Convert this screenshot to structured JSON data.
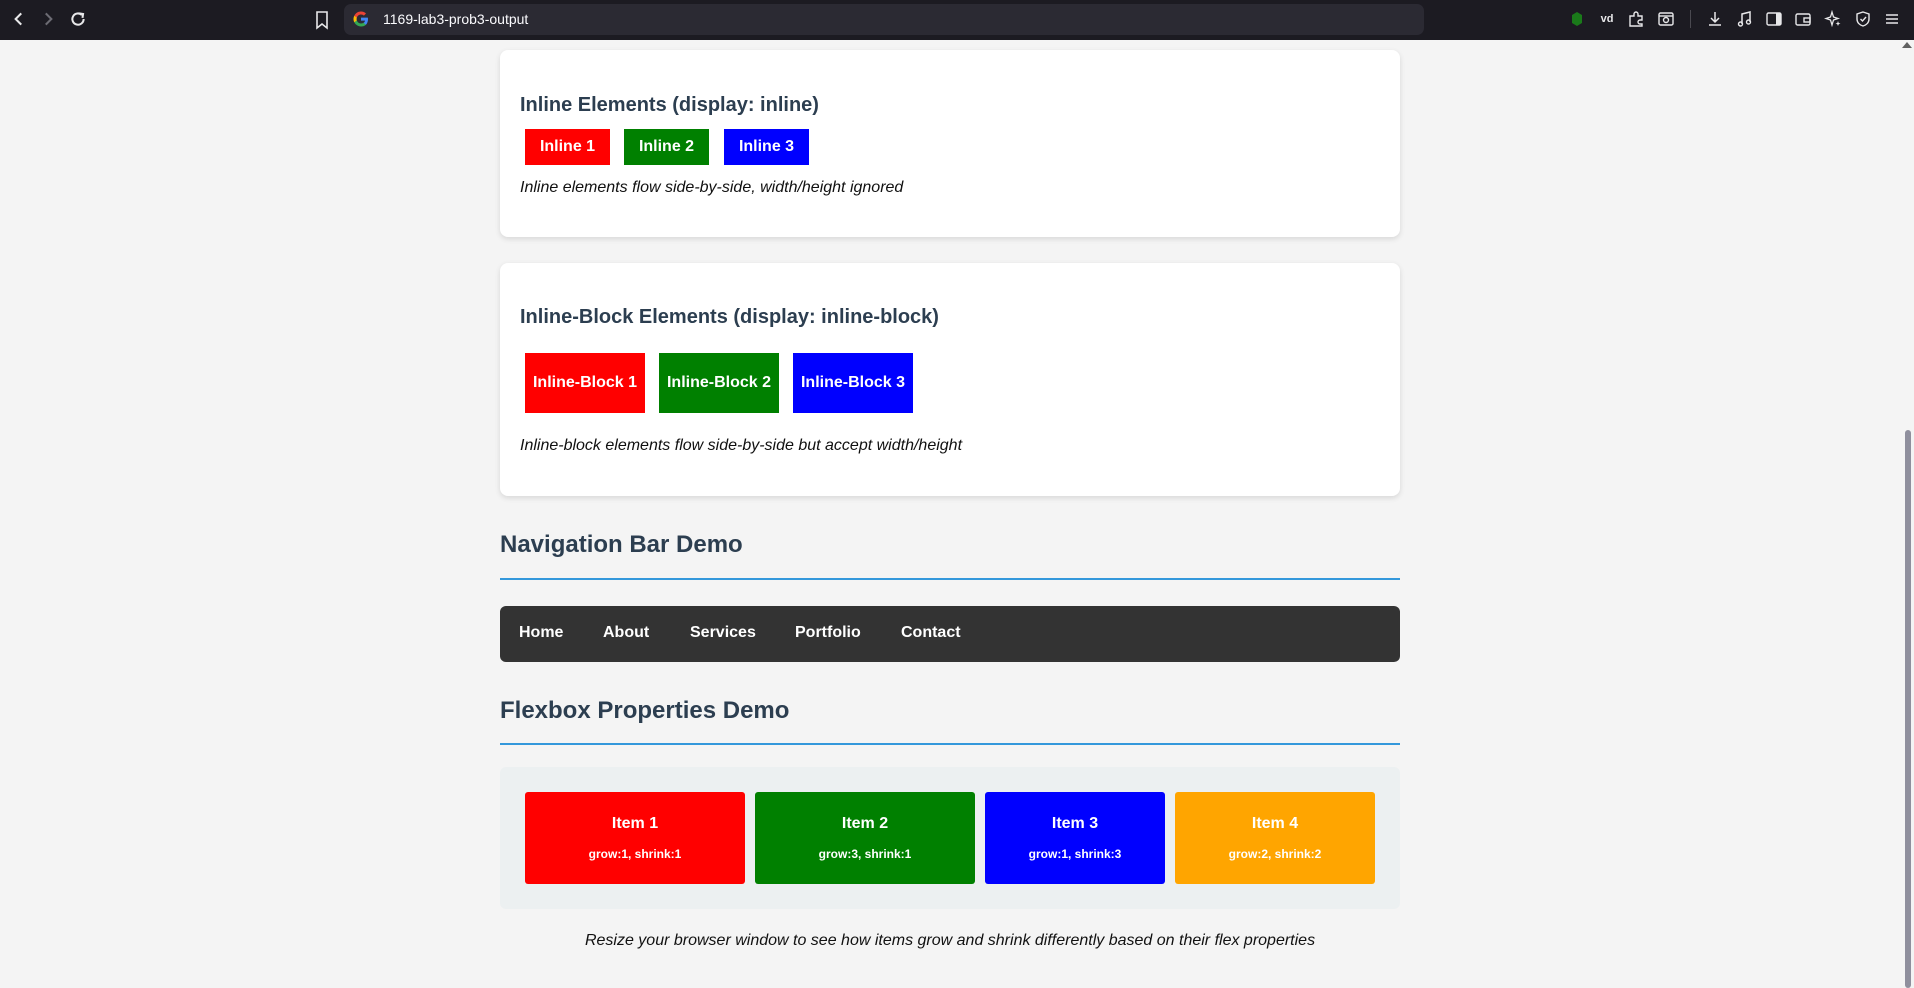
{
  "browser": {
    "url": "1169-lab3-prob3-output",
    "toolbar_icons": [
      "extension-icon",
      "vd-icon",
      "puzzle-icon",
      "screenshot-icon",
      "download-icon",
      "music-icon",
      "sidebar-icon",
      "wallet-icon",
      "ai-icon",
      "shield-icon",
      "menu-icon"
    ],
    "vd_label": "vd"
  },
  "inline_section": {
    "title": "Inline Elements (display: inline)",
    "items": [
      {
        "label": "Inline 1",
        "color": "#ff0000"
      },
      {
        "label": "Inline 2",
        "color": "#008000"
      },
      {
        "label": "Inline 3",
        "color": "#0000ff"
      }
    ],
    "note": "Inline elements flow side-by-side, width/height ignored"
  },
  "inline_block_section": {
    "title": "Inline-Block Elements (display: inline-block)",
    "items": [
      {
        "label": "Inline-Block 1",
        "color": "#ff0000"
      },
      {
        "label": "Inline-Block 2",
        "color": "#008000"
      },
      {
        "label": "Inline-Block 3",
        "color": "#0000ff"
      }
    ],
    "note": "Inline-block elements flow side-by-side but accept width/height"
  },
  "nav_demo": {
    "title": "Navigation Bar Demo",
    "links": [
      "Home",
      "About",
      "Services",
      "Portfolio",
      "Contact"
    ],
    "bar_color": "#333333"
  },
  "flex_demo": {
    "title": "Flexbox Properties Demo",
    "items": [
      {
        "title": "Item 1",
        "props": "grow:1, shrink:1",
        "color": "#ff0000"
      },
      {
        "title": "Item 2",
        "props": "grow:3, shrink:1",
        "color": "#008000"
      },
      {
        "title": "Item 3",
        "props": "grow:1, shrink:3",
        "color": "#0000ff"
      },
      {
        "title": "Item 4",
        "props": "grow:2, shrink:2",
        "color": "#ffa500"
      }
    ],
    "footnote": "Resize your browser window to see how items grow and shrink differently based on their flex properties"
  },
  "colors": {
    "heading": "#2c3e50",
    "accent_rule": "#3498db"
  }
}
